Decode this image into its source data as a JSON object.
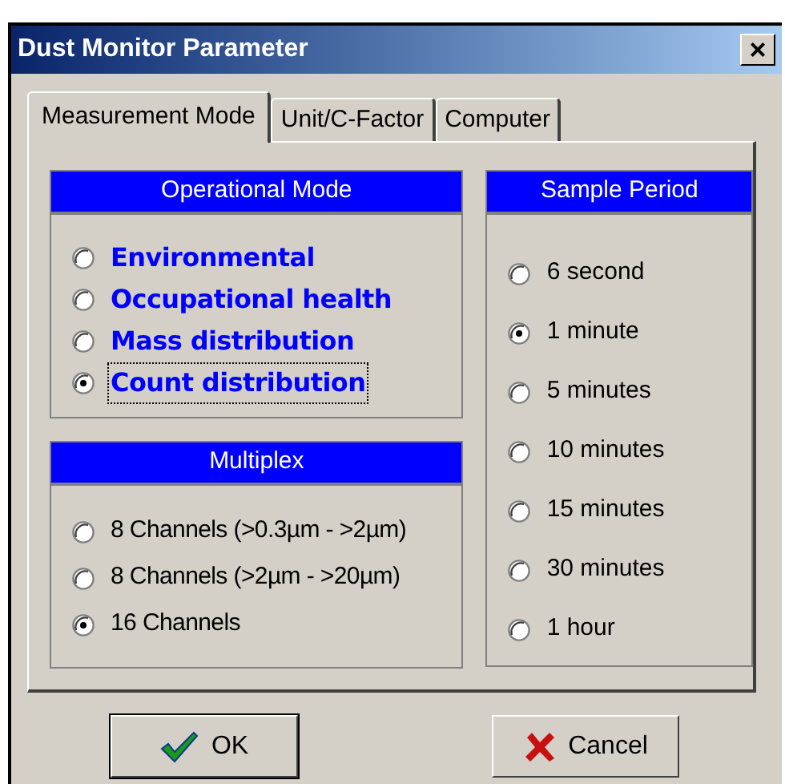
{
  "window": {
    "title": "Dust Monitor Parameter",
    "close": "×"
  },
  "tabs": [
    {
      "label": "Measurement Mode",
      "selected": true
    },
    {
      "label": "Unit/C-Factor",
      "selected": false
    },
    {
      "label": "Computer",
      "selected": false
    }
  ],
  "operational_mode": {
    "title": "Operational Mode",
    "options": [
      {
        "label": "Environmental",
        "selected": false
      },
      {
        "label": "Occupational health",
        "selected": false
      },
      {
        "label": "Mass distribution",
        "selected": false
      },
      {
        "label": "Count distribution",
        "selected": true
      }
    ]
  },
  "multiplex": {
    "title": "Multiplex",
    "options": [
      {
        "label": "8 Channels (>0.3µm - >2µm)",
        "selected": false
      },
      {
        "label": "8 Channels (>2µm - >20µm)",
        "selected": false
      },
      {
        "label": "16 Channels",
        "selected": true
      }
    ]
  },
  "sample_period": {
    "title": "Sample Period",
    "options": [
      {
        "label": "6 second",
        "selected": false
      },
      {
        "label": "1 minute",
        "selected": true
      },
      {
        "label": "5 minutes",
        "selected": false
      },
      {
        "label": "10 minutes",
        "selected": false
      },
      {
        "label": "15 minutes",
        "selected": false
      },
      {
        "label": "30 minutes",
        "selected": false
      },
      {
        "label": "1 hour",
        "selected": false
      }
    ]
  },
  "buttons": [
    {
      "kind": "ok",
      "label": "OK"
    },
    {
      "kind": "cancel",
      "label": "Cancel"
    }
  ]
}
